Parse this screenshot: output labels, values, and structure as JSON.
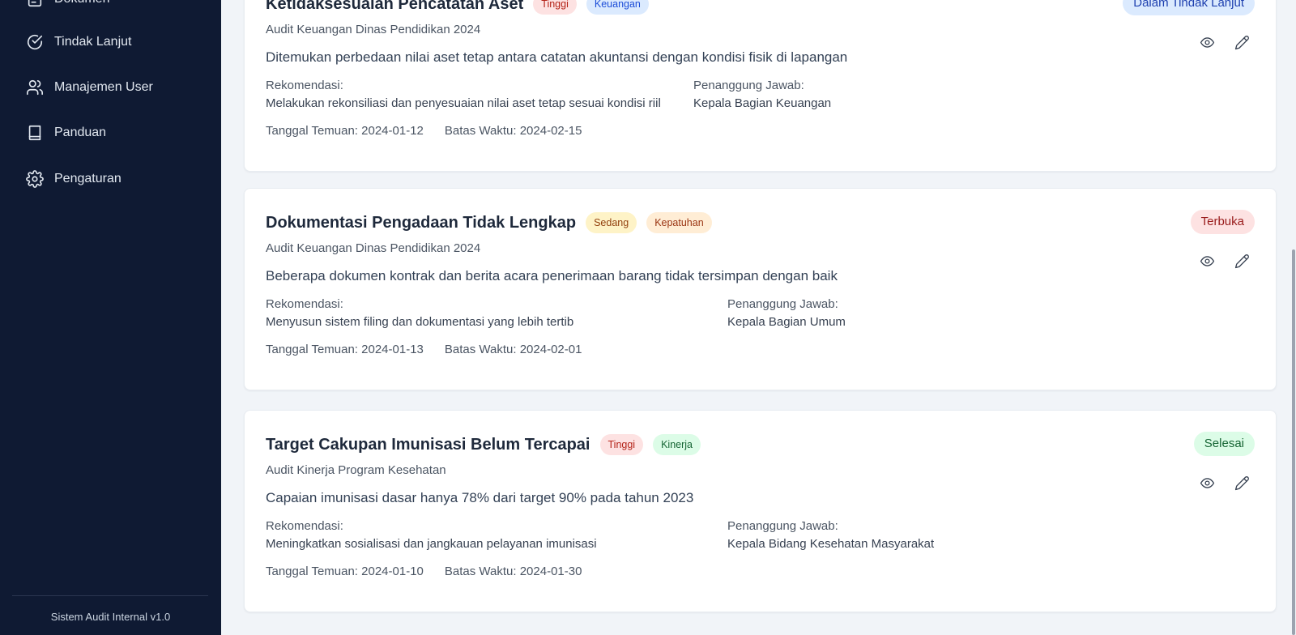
{
  "sidebar": {
    "items": [
      {
        "label": "Dokumen",
        "icon": "document-icon"
      },
      {
        "label": "Tindak Lanjut",
        "icon": "check-circle-icon"
      },
      {
        "label": "Manajemen User",
        "icon": "users-icon"
      },
      {
        "label": "Panduan",
        "icon": "book-icon"
      },
      {
        "label": "Pengaturan",
        "icon": "gear-icon"
      }
    ],
    "footer": "Sistem Audit Internal v1.0"
  },
  "labels": {
    "rekomendasi": "Rekomendasi:",
    "penanggung_jawab": "Penanggung Jawab:",
    "tanggal_temuan": "Tanggal Temuan:",
    "batas_waktu": "Batas Waktu:"
  },
  "findings": [
    {
      "title": "Ketidaksesuaian Pencatatan Aset",
      "severity": "Tinggi",
      "category": "Keuangan",
      "audit": "Audit Keuangan Dinas Pendidikan 2024",
      "description": "Ditemukan perbedaan nilai aset tetap antara catatan akuntansi dengan kondisi fisik di lapangan",
      "recommendation": "Melakukan rekonsiliasi dan penyesuaian nilai aset tetap sesuai kondisi riil",
      "responsible": "Kepala Bagian Keuangan",
      "found_date": "2024-01-12",
      "deadline": "2024-02-15",
      "status": "Dalam Tindak Lanjut"
    },
    {
      "title": "Dokumentasi Pengadaan Tidak Lengkap",
      "severity": "Sedang",
      "category": "Kepatuhan",
      "audit": "Audit Keuangan Dinas Pendidikan 2024",
      "description": "Beberapa dokumen kontrak dan berita acara penerimaan barang tidak tersimpan dengan baik",
      "recommendation": "Menyusun sistem filing dan dokumentasi yang lebih tertib",
      "responsible": "Kepala Bagian Umum",
      "found_date": "2024-01-13",
      "deadline": "2024-02-01",
      "status": "Terbuka"
    },
    {
      "title": "Target Cakupan Imunisasi Belum Tercapai",
      "severity": "Tinggi",
      "category": "Kinerja",
      "audit": "Audit Kinerja Program Kesehatan",
      "description": "Capaian imunisasi dasar hanya 78% dari target 90% pada tahun 2023",
      "recommendation": "Meningkatkan sosialisasi dan jangkauan pelayanan imunisasi",
      "responsible": "Kepala Bidang Kesehatan Masyarakat",
      "found_date": "2024-01-10",
      "deadline": "2024-01-30",
      "status": "Selesai"
    }
  ],
  "colors": {
    "sidebar_bg": "#0f1a33",
    "page_bg": "#f1f4f8",
    "tinggi_bg": "#fde2e2",
    "tinggi_fg": "#b42318",
    "sedang_bg": "#fef3c7",
    "sedang_fg": "#92400e",
    "keuangan_bg": "#dbeafe",
    "keuangan_fg": "#1d4ed8",
    "kepatuhan_bg": "#ffedd5",
    "kepatuhan_fg": "#9a3412",
    "kinerja_bg": "#dcfce7",
    "kinerja_fg": "#166534",
    "status_progress_bg": "#dbeafe",
    "status_progress_fg": "#1e40af",
    "status_open_bg": "#fde2e2",
    "status_open_fg": "#991b1b",
    "status_done_bg": "#dcfce7",
    "status_done_fg": "#166534"
  }
}
